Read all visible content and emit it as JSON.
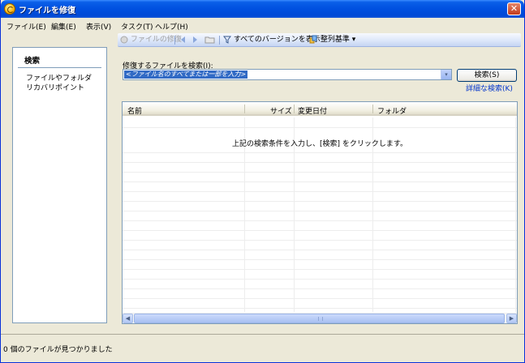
{
  "window": {
    "title": "ファイルを修復",
    "close_glyph": "✕"
  },
  "menubar": {
    "items": [
      "ファイル(E)",
      "編集(E)",
      "表示(V)",
      "タスク(T)",
      "ヘルプ(H)"
    ]
  },
  "sidebar": {
    "header": "検索",
    "items": [
      "ファイルやフォルダ",
      "リカバリポイント"
    ]
  },
  "toolbar": {
    "repair_label": "ファイルの修復",
    "all_versions_label": "すべてのバージョンを表示",
    "sort_label": "整列基準",
    "sort_arrow": "▾"
  },
  "search": {
    "label": "修復するファイルを検索(I):",
    "placeholder": "<ファイル名のすべてまたは一部を入力>",
    "button_label": "検索(S)",
    "advanced_link": "詳細な検索(K)",
    "combo_arrow": "▾"
  },
  "results": {
    "columns": [
      "名前",
      "サイズ",
      "変更日付",
      "フォルダ"
    ],
    "empty_message": "上記の検索条件を入力し、[検索] をクリックします。",
    "scroll_left": "◀",
    "scroll_right": "▶"
  },
  "status": {
    "text": "0 個のファイルが見つかりました"
  },
  "colors": {
    "titlebar": "#0050E0",
    "link": "#0033CC",
    "selection": "#316AC5",
    "window_bg": "#ECE9D8"
  }
}
